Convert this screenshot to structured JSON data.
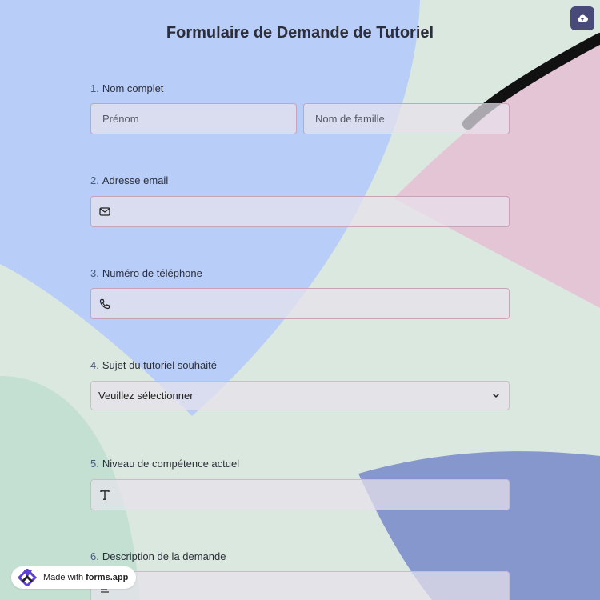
{
  "form": {
    "title": "Formulaire de Demande de Tutoriel",
    "questions": [
      {
        "number": "1.",
        "label": "Nom complet",
        "first_placeholder": "Prénom",
        "last_placeholder": "Nom de famille"
      },
      {
        "number": "2.",
        "label": "Adresse email",
        "icon": "mail-icon"
      },
      {
        "number": "3.",
        "label": "Numéro de téléphone",
        "icon": "phone-icon"
      },
      {
        "number": "4.",
        "label": "Sujet du tutoriel souhaité",
        "selected": "Veuillez sélectionner"
      },
      {
        "number": "5.",
        "label": "Niveau de compétence actuel",
        "icon": "text-icon"
      },
      {
        "number": "6.",
        "label": "Description de la demande",
        "icon": "textarea-icon"
      }
    ]
  },
  "badge": {
    "prefix": "Made with",
    "brand": "forms.app"
  },
  "colors": {
    "accent": "#4a4a7a",
    "blue_shape": "#b8cdf8",
    "pink_shape": "#e4c5d6",
    "navy_shape": "#8597cc",
    "green_shape": "#c3e0d3"
  }
}
